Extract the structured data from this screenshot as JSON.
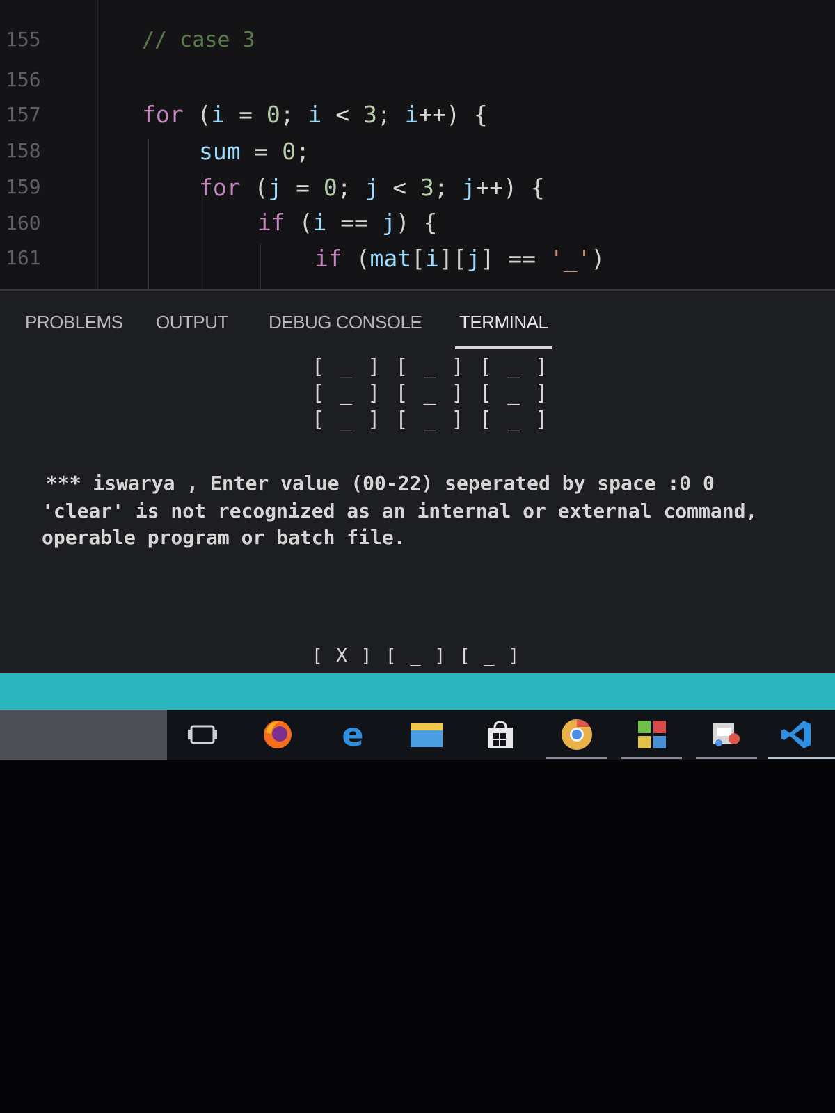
{
  "editor": {
    "line_numbers": [
      "155",
      "156",
      "157",
      "158",
      "159",
      "160",
      "161"
    ],
    "comment": "// case 3",
    "lines": [
      {
        "t1": "for",
        "t2": " (",
        "t3": "i",
        "t4": " = ",
        "t5": "0",
        "t6": "; ",
        "t7": "i",
        "t8": " < ",
        "t9": "3",
        "t10": "; ",
        "t11": "i",
        "t12": "++) {"
      },
      {
        "t1": "sum",
        "t2": " = ",
        "t3": "0",
        "t4": ";"
      },
      {
        "t1": "for",
        "t2": " (",
        "t3": "j",
        "t4": " = ",
        "t5": "0",
        "t6": "; ",
        "t7": "j",
        "t8": " < ",
        "t9": "3",
        "t10": "; ",
        "t11": "j",
        "t12": "++) {"
      },
      {
        "t1": "if",
        "t2": " (",
        "t3": "i",
        "t4": " == ",
        "t5": "j",
        "t6": ") {"
      },
      {
        "t1": "if",
        "t2": " (",
        "t3": "mat",
        "t4": "[",
        "t5": "i",
        "t6": "][",
        "t7": "j",
        "t8": "] == ",
        "t9": "'_'",
        "t10": ")"
      }
    ]
  },
  "panel": {
    "tabs": [
      "PROBLEMS",
      "OUTPUT",
      "DEBUG CONSOLE",
      "TERMINAL"
    ],
    "active_tab": "TERMINAL",
    "board_top": [
      "[ _ ] [ _ ] [ _ ]",
      "[ _ ] [ _ ] [ _ ]",
      "[ _ ] [ _ ] [ _ ]"
    ],
    "output_lines": [
      "*** iswarya , Enter value (00-22) seperated by space :0 0",
      "'clear' is not recognized as an internal or external command,",
      "operable program or batch file."
    ],
    "board_bottom": "[ X ] [ _ ] [ _ ]"
  },
  "colors": {
    "statusbar": "#2bb6bd",
    "keyword": "#c586c0",
    "variable": "#9cdcfe",
    "number": "#b5cea8",
    "string": "#ce9178"
  },
  "taskbar": {
    "icons": [
      "task-view-icon",
      "firefox-icon",
      "edge-icon",
      "file-explorer-icon",
      "store-icon",
      "chrome-icon",
      "codeblocks-icon",
      "paint-icon",
      "vscode-icon"
    ]
  }
}
